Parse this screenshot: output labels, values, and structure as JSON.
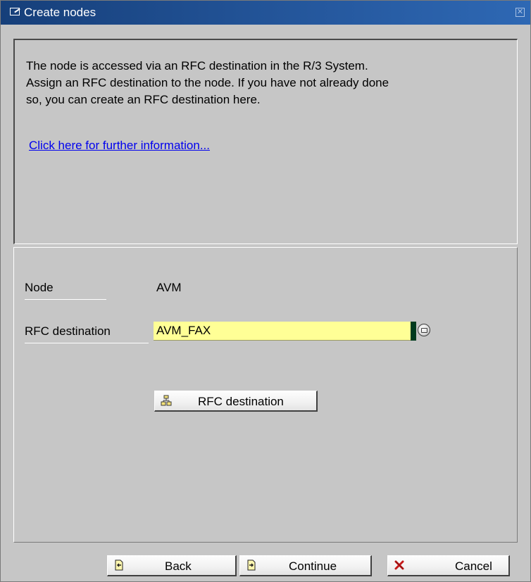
{
  "window": {
    "title": "Create nodes"
  },
  "info": {
    "text": "The node is accessed via an RFC destination in the R/3 System.\nAssign an RFC destination to the node. If you have not already done\nso, you can create an RFC destination here.",
    "link": "Click here for further information..."
  },
  "form": {
    "node_label": "Node",
    "node_value": "AVM",
    "rfc_label": "RFC destination",
    "rfc_value": "AVM_FAX",
    "rfc_button_label": "RFC destination",
    "colors": {
      "required_field": "#ffff96"
    }
  },
  "footer": {
    "back_label": "Back",
    "continue_label": "Continue",
    "cancel_label": "Cancel"
  },
  "icons": {
    "title": "window-icon",
    "close": "close-icon",
    "f4": "value-help-icon",
    "rfc": "network-hierarchy-icon",
    "back": "page-back-icon",
    "continue": "page-forward-icon",
    "cancel": "red-x-icon"
  }
}
